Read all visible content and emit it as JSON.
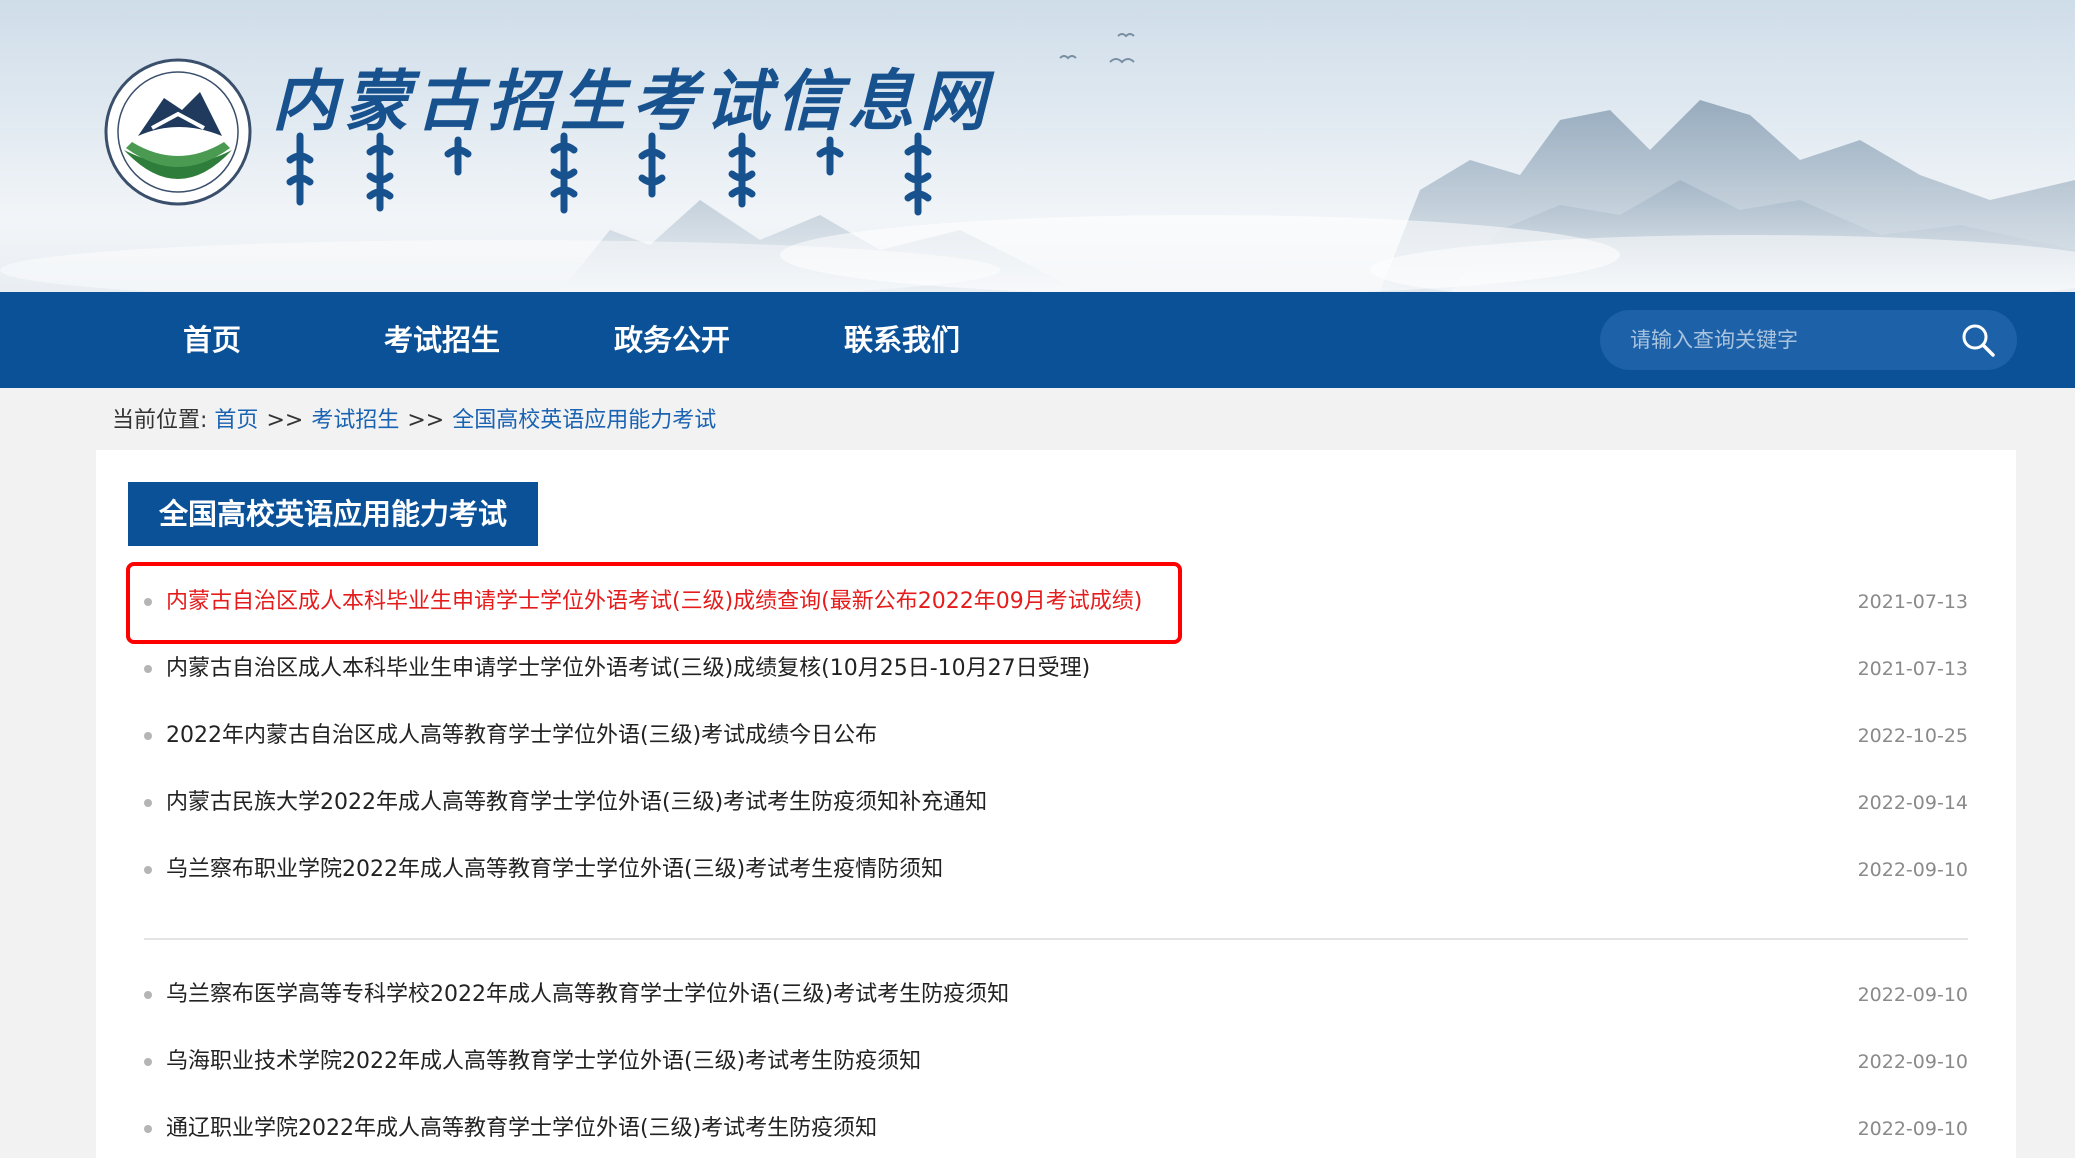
{
  "site": {
    "title": "内蒙古招生考试信息网",
    "brand_color": "#0b5198"
  },
  "nav": {
    "items": [
      {
        "label": "首页"
      },
      {
        "label": "考试招生"
      },
      {
        "label": "政务公开"
      },
      {
        "label": "联系我们"
      }
    ],
    "search_placeholder": "请输入查询关键字",
    "search_icon": "search-icon"
  },
  "breadcrumb": {
    "prefix": "当前位置:",
    "items": [
      "首页",
      "考试招生",
      "全国高校英语应用能力考试"
    ],
    "separator": ">>"
  },
  "section": {
    "title": "全国高校英语应用能力考试"
  },
  "highlight_color": "#ff0000",
  "list": [
    {
      "title": "内蒙古自治区成人本科毕业生申请学士学位外语考试(三级)成绩查询(最新公布2022年09月考试成绩)",
      "date": "2021-07-13",
      "highlighted": true
    },
    {
      "title": "内蒙古自治区成人本科毕业生申请学士学位外语考试(三级)成绩复核(10月25日-10月27日受理)",
      "date": "2021-07-13"
    },
    {
      "title": "2022年内蒙古自治区成人高等教育学士学位外语(三级)考试成绩今日公布",
      "date": "2022-10-25"
    },
    {
      "title": "内蒙古民族大学2022年成人高等教育学士学位外语(三级)考试考生防疫须知补充通知",
      "date": "2022-09-14"
    },
    {
      "title": "乌兰察布职业学院2022年成人高等教育学士学位外语(三级)考试考生疫情防须知",
      "date": "2022-09-10"
    },
    {
      "title": "乌兰察布医学高等专科学校2022年成人高等教育学士学位外语(三级)考试考生防疫须知",
      "date": "2022-09-10"
    },
    {
      "title": "乌海职业技术学院2022年成人高等教育学士学位外语(三级)考试考生防疫须知",
      "date": "2022-09-10"
    },
    {
      "title": "通辽职业学院2022年成人高等教育学士学位外语(三级)考试考生防疫须知",
      "date": "2022-09-10"
    }
  ]
}
